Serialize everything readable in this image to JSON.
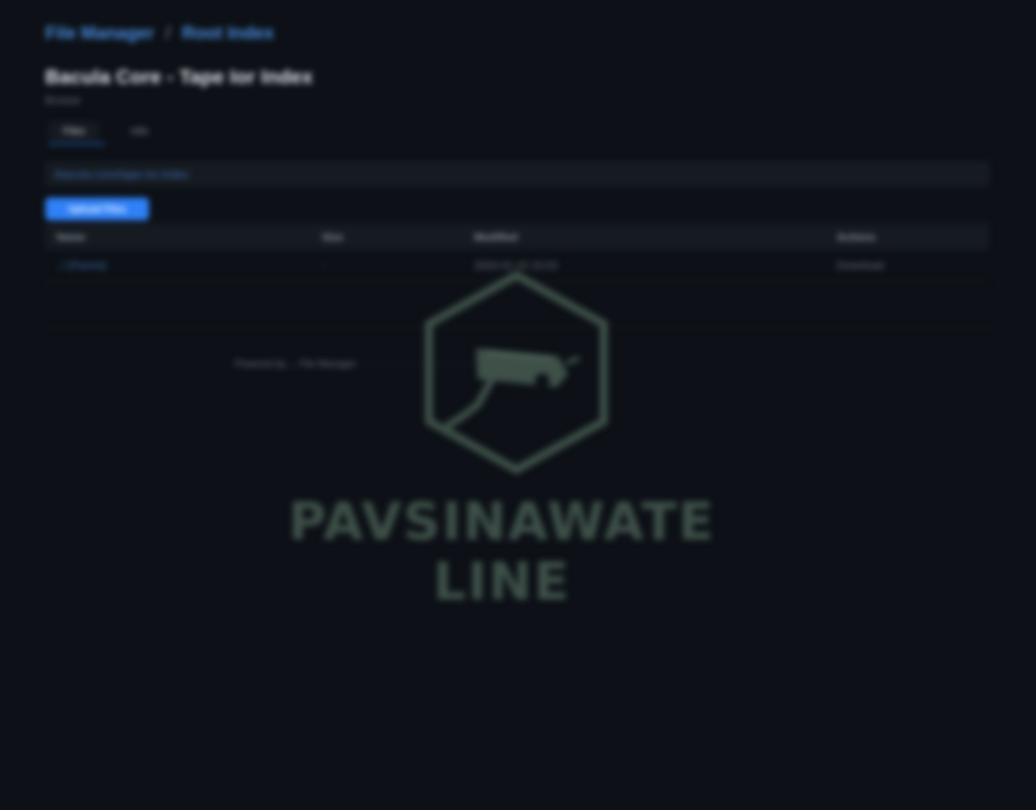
{
  "breadcrumb": {
    "root": "File Manager",
    "current": "Root Index",
    "separator": "/"
  },
  "header": {
    "title": "Bacula Core - Tape Ior Index",
    "subtitle": "Browse"
  },
  "tabs": [
    {
      "label": "Files"
    },
    {
      "label": "Info"
    }
  ],
  "path_field": {
    "value": "/bacula-core/tape-ior-index"
  },
  "upload_button": {
    "label": "Upload Files"
  },
  "file_table": {
    "columns": [
      "Name",
      "Size",
      "Modified",
      "Actions"
    ],
    "rows": [
      {
        "name": "../ (Parent)",
        "size": "-",
        "modified": "2024-01-15 10:23",
        "actions": "Download"
      }
    ]
  },
  "footer": {
    "text": "Powered by ... File Manager · · · · · · · · · · · · · · · · · · · · · · · · · ·"
  },
  "watermark": {
    "text": "PAVSINAWATE LINE",
    "color": "#3e5048"
  },
  "colors": {
    "background": "#0d1117",
    "accent": "#2f81f7",
    "link": "#4a8ee0"
  }
}
